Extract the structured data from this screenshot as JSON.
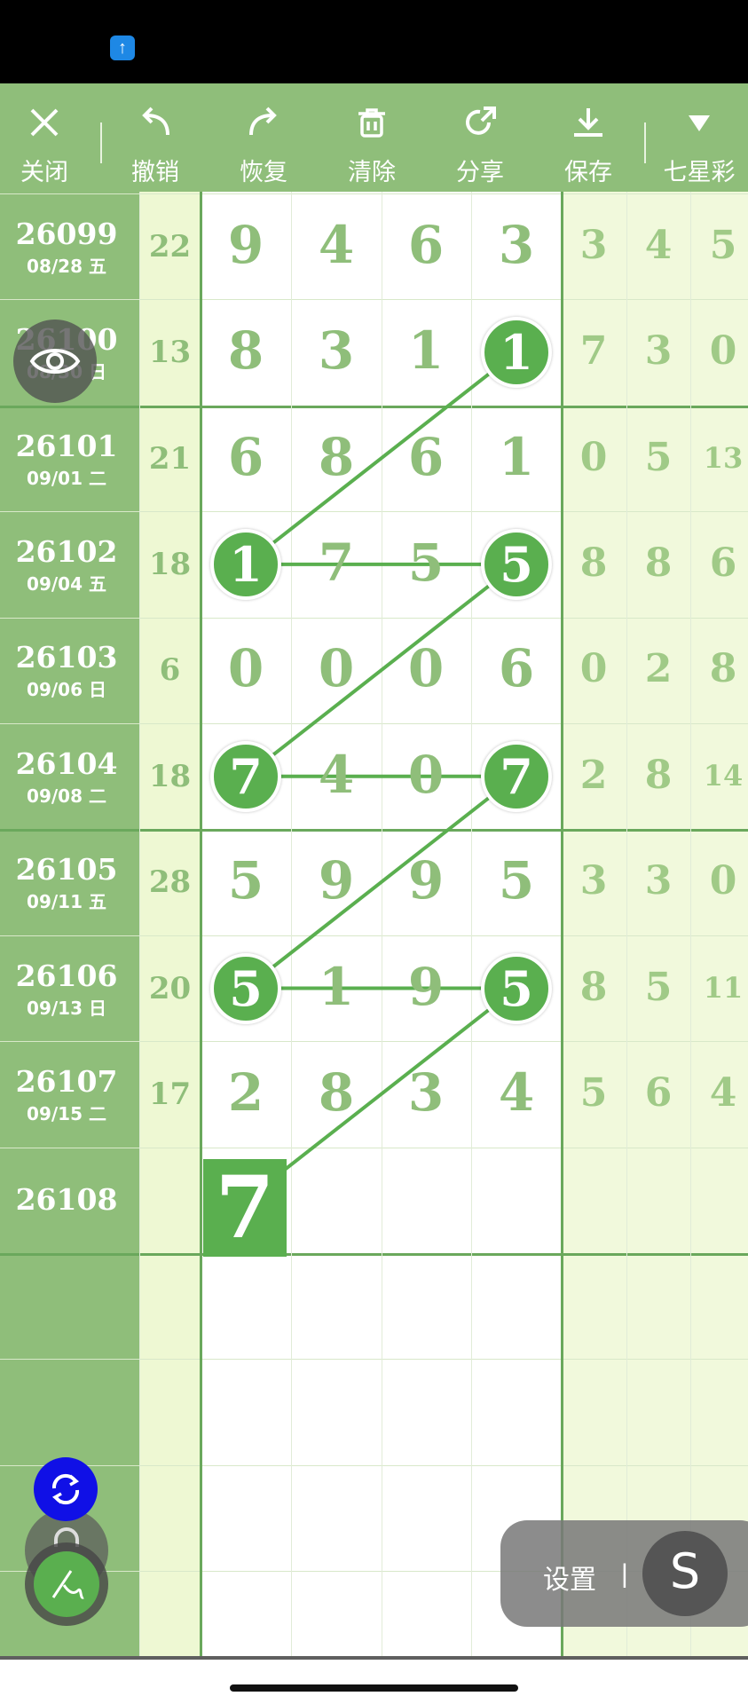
{
  "toolbar": {
    "close": "关闭",
    "undo": "撤销",
    "redo": "恢复",
    "clear": "清除",
    "share": "分享",
    "save": "保存",
    "lottery": "七星彩"
  },
  "rows": [
    {
      "period": "26099",
      "date": "08/28 五",
      "sum": "22",
      "digits": [
        "9",
        "4",
        "6",
        "3"
      ],
      "right": [
        "3",
        "4",
        "5"
      ]
    },
    {
      "period": "26100",
      "date": "08/30 日",
      "sum": "13",
      "digits": [
        "8",
        "3",
        "1",
        "1"
      ],
      "right": [
        "7",
        "3",
        "0"
      ]
    },
    {
      "period": "26101",
      "date": "09/01 二",
      "sum": "21",
      "digits": [
        "6",
        "8",
        "6",
        "1"
      ],
      "right": [
        "0",
        "5",
        "13"
      ]
    },
    {
      "period": "26102",
      "date": "09/04 五",
      "sum": "18",
      "digits": [
        "1",
        "7",
        "5",
        "5"
      ],
      "right": [
        "8",
        "8",
        "6"
      ]
    },
    {
      "period": "26103",
      "date": "09/06 日",
      "sum": "6",
      "digits": [
        "0",
        "0",
        "0",
        "6"
      ],
      "right": [
        "0",
        "2",
        "8"
      ]
    },
    {
      "period": "26104",
      "date": "09/08 二",
      "sum": "18",
      "digits": [
        "7",
        "4",
        "0",
        "7"
      ],
      "right": [
        "2",
        "8",
        "14"
      ]
    },
    {
      "period": "26105",
      "date": "09/11 五",
      "sum": "28",
      "digits": [
        "5",
        "9",
        "9",
        "5"
      ],
      "right": [
        "3",
        "3",
        "0"
      ]
    },
    {
      "period": "26106",
      "date": "09/13 日",
      "sum": "20",
      "digits": [
        "5",
        "1",
        "9",
        "5"
      ],
      "right": [
        "8",
        "5",
        "11"
      ]
    },
    {
      "period": "26107",
      "date": "09/15 二",
      "sum": "17",
      "digits": [
        "2",
        "8",
        "3",
        "4"
      ],
      "right": [
        "5",
        "6",
        "4"
      ]
    },
    {
      "period": "26108",
      "date": "",
      "sum": "",
      "digits": [
        "",
        "",
        "",
        ""
      ],
      "right": [
        "",
        "",
        ""
      ]
    }
  ],
  "pending_value": "7",
  "settings": {
    "label": "设置",
    "separator": "|",
    "button": "S"
  },
  "colors": {
    "accent": "#8fbe7a",
    "highlight": "#5aaf4f",
    "sync": "#1010e6"
  },
  "icons": [
    "status-app-icon",
    "close-icon",
    "undo-icon",
    "redo-icon",
    "trash-icon",
    "share-icon",
    "download-icon",
    "dropdown-triangle-icon",
    "eye-icon",
    "sync-icon",
    "lock-icon",
    "pen-icon"
  ]
}
